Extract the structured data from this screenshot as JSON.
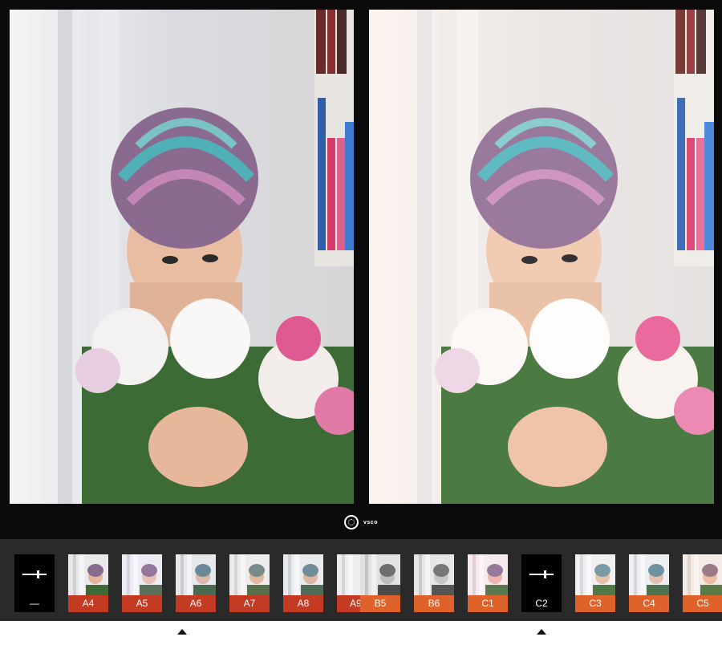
{
  "app": {
    "brand": "vsco",
    "logo_icon": "vsco-circle-icon"
  },
  "colors": {
    "label_red": "#c23b22",
    "label_orange": "#e0622b",
    "strip_bg": "#2a2a2a"
  },
  "filters": {
    "edit_tool_left": {
      "label": "—",
      "icon": "adjust-slider-icon"
    },
    "items": [
      {
        "label": "A4"
      },
      {
        "label": "A5"
      },
      {
        "label": "A6"
      },
      {
        "label": "A7"
      },
      {
        "label": "A8"
      },
      {
        "label": "A9"
      },
      {
        "label": "B5"
      },
      {
        "label": "B6"
      },
      {
        "label": "C1"
      },
      {
        "label": "C2",
        "icon": "adjust-slider-icon"
      },
      {
        "label": "C3"
      },
      {
        "label": "C4"
      },
      {
        "label": "C5"
      }
    ]
  }
}
